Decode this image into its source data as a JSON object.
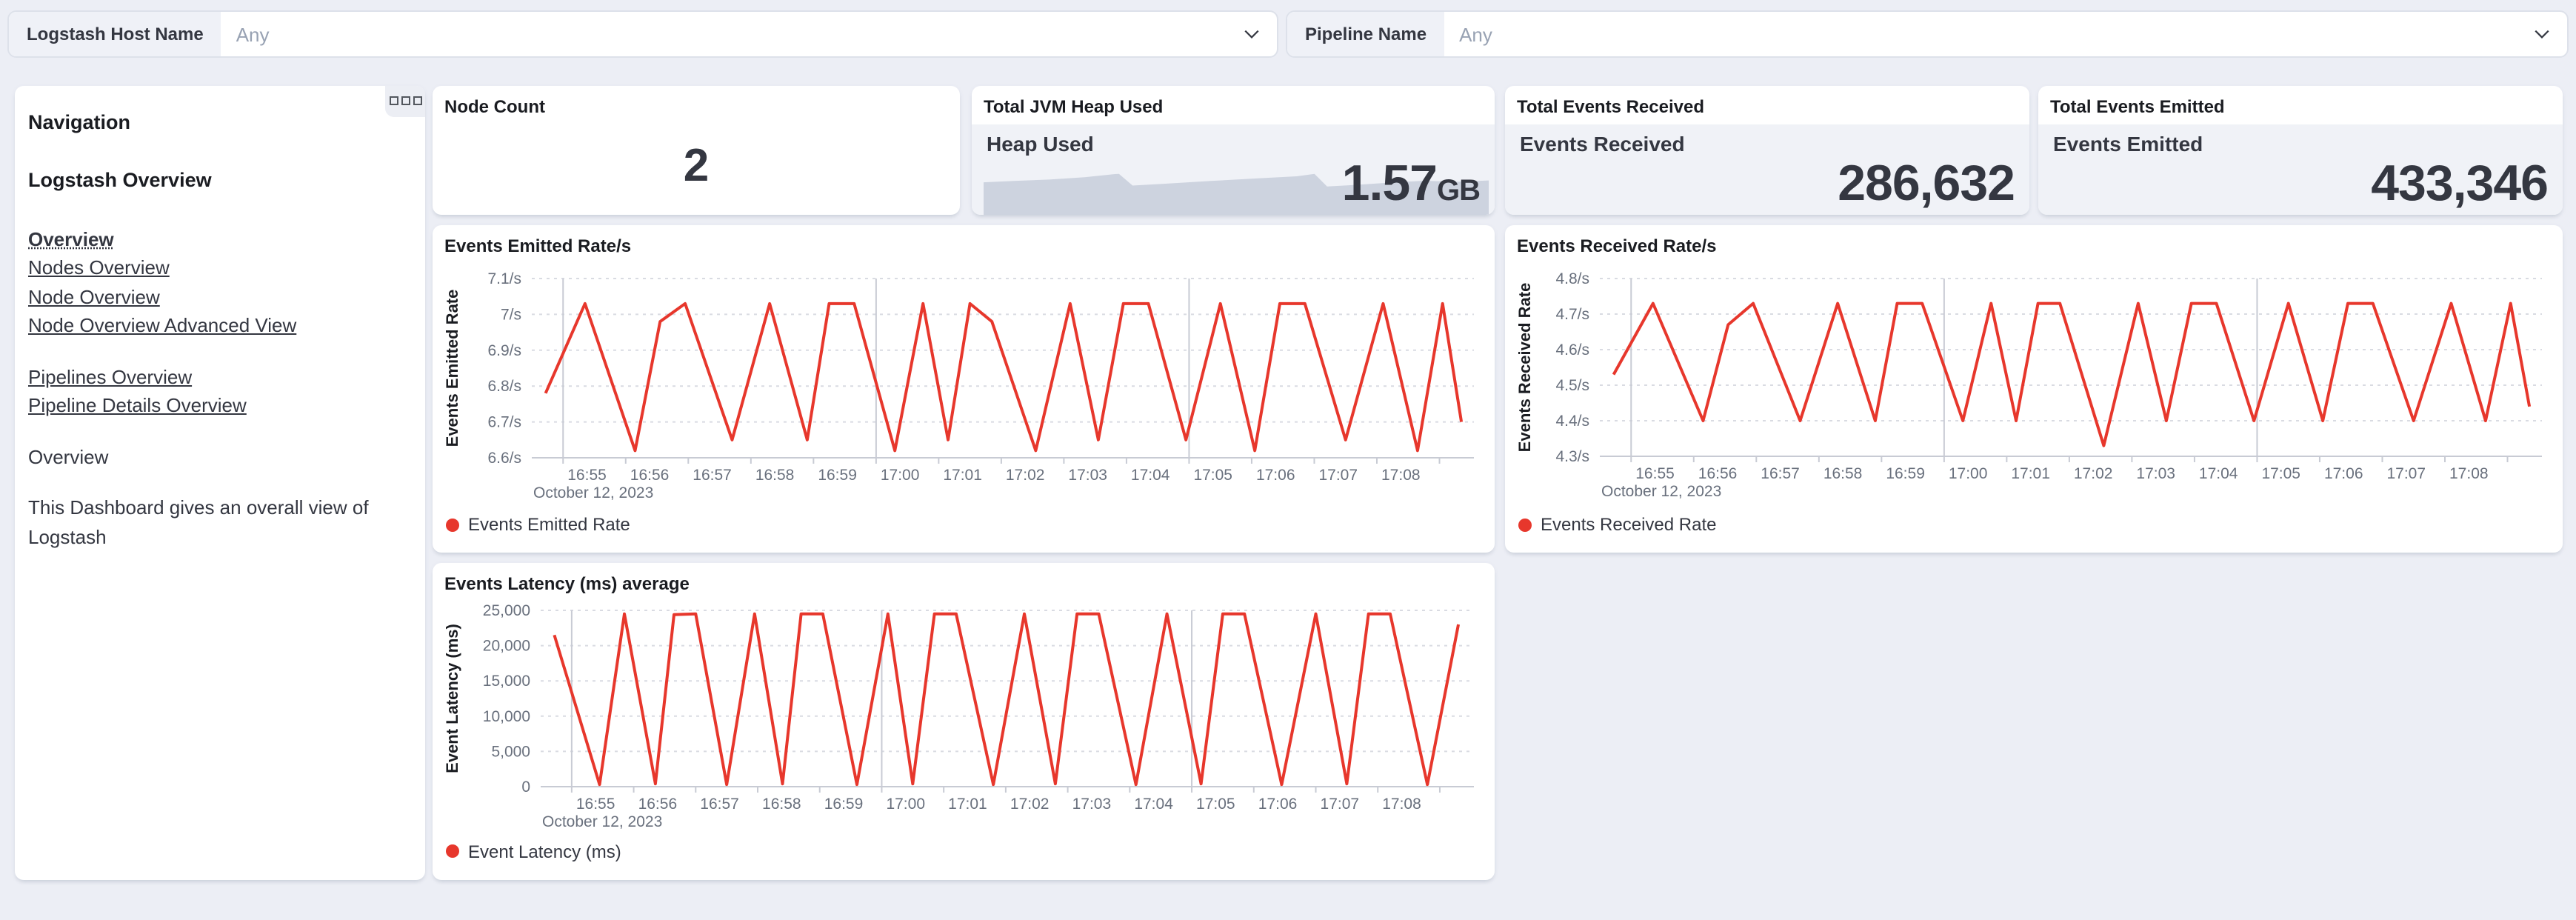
{
  "filters": {
    "host": {
      "label": "Logstash Host Name",
      "value": "Any"
    },
    "pipeline": {
      "label": "Pipeline Name",
      "value": "Any"
    }
  },
  "navigation": {
    "heading": "Navigation",
    "subheading": "Logstash Overview",
    "links_primary": [
      "Overview",
      "Nodes Overview",
      "Node Overview",
      "Node Overview Advanced View"
    ],
    "links_secondary": [
      "Pipelines Overview",
      "Pipeline Details Overview"
    ],
    "section_title": "Overview",
    "description": "This Dashboard gives an overall view of Logstash"
  },
  "metrics": {
    "node_count": {
      "title": "Node Count",
      "value": "2"
    },
    "jvm_heap": {
      "title": "Total JVM Heap Used",
      "label": "Heap Used",
      "value": "1.57",
      "unit": "GB",
      "trend": [
        [
          0,
          0.37
        ],
        [
          0.06,
          0.385
        ],
        [
          0.13,
          0.4
        ],
        [
          0.2,
          0.425
        ],
        [
          0.26,
          0.46
        ],
        [
          0.268,
          0.462
        ],
        [
          0.295,
          0.335
        ],
        [
          0.36,
          0.355
        ],
        [
          0.45,
          0.385
        ],
        [
          0.55,
          0.415
        ],
        [
          0.62,
          0.435
        ],
        [
          0.655,
          0.462
        ],
        [
          0.68,
          0.325
        ],
        [
          0.73,
          0.34
        ],
        [
          0.8,
          0.365
        ],
        [
          0.87,
          0.387
        ],
        [
          0.94,
          0.376
        ],
        [
          1,
          0.39
        ]
      ]
    },
    "events_received": {
      "title": "Total Events Received",
      "label": "Events Received",
      "value": "286,632"
    },
    "events_emitted": {
      "title": "Total Events Emitted",
      "label": "Events Emitted",
      "value": "433,346"
    }
  },
  "chart_data": [
    {
      "type": "line",
      "title": "Events Emitted Rate/s",
      "ylabel": "Events Emitted Rate",
      "legend": "Events Emitted Rate",
      "xlabel_date": "October 12, 2023",
      "ydomain": [
        6.6,
        7.1
      ],
      "yticks": [
        {
          "v": 7.1,
          "label": "7.1/s"
        },
        {
          "v": 7.0,
          "label": "7/s"
        },
        {
          "v": 6.9,
          "label": "6.9/s"
        },
        {
          "v": 6.8,
          "label": "6.8/s"
        },
        {
          "v": 6.7,
          "label": "6.7/s"
        },
        {
          "v": 6.6,
          "label": "6.6/s"
        }
      ],
      "xdomain_minutes": [
        54.5,
        69.55
      ],
      "xticks": [
        {
          "t": 55,
          "label": "16:55"
        },
        {
          "t": 56,
          "label": "16:56"
        },
        {
          "t": 57,
          "label": "16:57"
        },
        {
          "t": 58,
          "label": "16:58"
        },
        {
          "t": 59,
          "label": "16:59"
        },
        {
          "t": 60,
          "label": "17:00"
        },
        {
          "t": 61,
          "label": "17:01"
        },
        {
          "t": 62,
          "label": "17:02"
        },
        {
          "t": 63,
          "label": "17:03"
        },
        {
          "t": 64,
          "label": "17:04"
        },
        {
          "t": 65,
          "label": "17:05"
        },
        {
          "t": 66,
          "label": "17:06"
        },
        {
          "t": 67,
          "label": "17:07"
        },
        {
          "t": 68,
          "label": "17:08"
        },
        {
          "t": 69,
          "label": ""
        }
      ],
      "vlines_minutes": [
        55,
        60,
        65
      ],
      "series": [
        {
          "name": "Events Emitted Rate",
          "color": "#e7372c",
          "points": [
            [
              54.72,
              6.78
            ],
            [
              55.35,
              7.03
            ],
            [
              56.15,
              6.62
            ],
            [
              56.55,
              6.98
            ],
            [
              56.95,
              7.03
            ],
            [
              57.7,
              6.65
            ],
            [
              58.3,
              7.03
            ],
            [
              58.9,
              6.65
            ],
            [
              59.25,
              7.03
            ],
            [
              59.65,
              7.03
            ],
            [
              60.3,
              6.62
            ],
            [
              60.75,
              7.03
            ],
            [
              61.15,
              6.65
            ],
            [
              61.5,
              7.03
            ],
            [
              61.85,
              6.98
            ],
            [
              62.55,
              6.62
            ],
            [
              63.1,
              7.03
            ],
            [
              63.55,
              6.65
            ],
            [
              63.95,
              7.03
            ],
            [
              64.35,
              7.03
            ],
            [
              64.95,
              6.65
            ],
            [
              65.5,
              7.03
            ],
            [
              66.05,
              6.62
            ],
            [
              66.45,
              7.03
            ],
            [
              66.85,
              7.03
            ],
            [
              67.5,
              6.65
            ],
            [
              68.1,
              7.03
            ],
            [
              68.65,
              6.62
            ],
            [
              69.05,
              7.03
            ],
            [
              69.35,
              6.7
            ]
          ]
        }
      ]
    },
    {
      "type": "line",
      "title": "Events Received Rate/s",
      "ylabel": "Events Received Rate",
      "legend": "Events Received Rate",
      "xlabel_date": "October 12, 2023",
      "ydomain": [
        4.3,
        4.8
      ],
      "yticks": [
        {
          "v": 4.8,
          "label": "4.8/s"
        },
        {
          "v": 4.7,
          "label": "4.7/s"
        },
        {
          "v": 4.6,
          "label": "4.6/s"
        },
        {
          "v": 4.5,
          "label": "4.5/s"
        },
        {
          "v": 4.4,
          "label": "4.4/s"
        },
        {
          "v": 4.3,
          "label": "4.3/s"
        }
      ],
      "xdomain_minutes": [
        54.5,
        69.55
      ],
      "xticks": [
        {
          "t": 55,
          "label": "16:55"
        },
        {
          "t": 56,
          "label": "16:56"
        },
        {
          "t": 57,
          "label": "16:57"
        },
        {
          "t": 58,
          "label": "16:58"
        },
        {
          "t": 59,
          "label": "16:59"
        },
        {
          "t": 60,
          "label": "17:00"
        },
        {
          "t": 61,
          "label": "17:01"
        },
        {
          "t": 62,
          "label": "17:02"
        },
        {
          "t": 63,
          "label": "17:03"
        },
        {
          "t": 64,
          "label": "17:04"
        },
        {
          "t": 65,
          "label": "17:05"
        },
        {
          "t": 66,
          "label": "17:06"
        },
        {
          "t": 67,
          "label": "17:07"
        },
        {
          "t": 68,
          "label": "17:08"
        },
        {
          "t": 69,
          "label": ""
        }
      ],
      "vlines_minutes": [
        55,
        60,
        65
      ],
      "series": [
        {
          "name": "Events Received Rate",
          "color": "#e7372c",
          "points": [
            [
              54.72,
              4.53
            ],
            [
              55.35,
              4.73
            ],
            [
              56.15,
              4.4
            ],
            [
              56.55,
              4.67
            ],
            [
              56.95,
              4.73
            ],
            [
              57.7,
              4.4
            ],
            [
              58.3,
              4.73
            ],
            [
              58.9,
              4.4
            ],
            [
              59.25,
              4.73
            ],
            [
              59.65,
              4.73
            ],
            [
              60.3,
              4.4
            ],
            [
              60.75,
              4.73
            ],
            [
              61.15,
              4.4
            ],
            [
              61.5,
              4.73
            ],
            [
              61.85,
              4.73
            ],
            [
              62.55,
              4.33
            ],
            [
              63.1,
              4.73
            ],
            [
              63.55,
              4.4
            ],
            [
              63.95,
              4.73
            ],
            [
              64.35,
              4.73
            ],
            [
              64.95,
              4.4
            ],
            [
              65.5,
              4.73
            ],
            [
              66.05,
              4.4
            ],
            [
              66.45,
              4.73
            ],
            [
              66.85,
              4.73
            ],
            [
              67.5,
              4.4
            ],
            [
              68.1,
              4.73
            ],
            [
              68.65,
              4.4
            ],
            [
              69.05,
              4.73
            ],
            [
              69.35,
              4.44
            ]
          ]
        }
      ]
    },
    {
      "type": "line",
      "title": "Events Latency (ms) average",
      "ylabel": "Event Latency (ms)",
      "legend": "Event Latency (ms)",
      "xlabel_date": "October 12, 2023",
      "ydomain": [
        0,
        25000
      ],
      "yticks": [
        {
          "v": 25000,
          "label": "25,000"
        },
        {
          "v": 20000,
          "label": "20,000"
        },
        {
          "v": 15000,
          "label": "15,000"
        },
        {
          "v": 10000,
          "label": "10,000"
        },
        {
          "v": 5000,
          "label": "5,000"
        },
        {
          "v": 0,
          "label": "0"
        }
      ],
      "xdomain_minutes": [
        54.5,
        69.55
      ],
      "xticks": [
        {
          "t": 55,
          "label": "16:55"
        },
        {
          "t": 56,
          "label": "16:56"
        },
        {
          "t": 57,
          "label": "16:57"
        },
        {
          "t": 58,
          "label": "16:58"
        },
        {
          "t": 59,
          "label": "16:59"
        },
        {
          "t": 60,
          "label": "17:00"
        },
        {
          "t": 61,
          "label": "17:01"
        },
        {
          "t": 62,
          "label": "17:02"
        },
        {
          "t": 63,
          "label": "17:03"
        },
        {
          "t": 64,
          "label": "17:04"
        },
        {
          "t": 65,
          "label": "17:05"
        },
        {
          "t": 66,
          "label": "17:06"
        },
        {
          "t": 67,
          "label": "17:07"
        },
        {
          "t": 68,
          "label": "17:08"
        },
        {
          "t": 69,
          "label": ""
        }
      ],
      "vlines_minutes": [
        55,
        60,
        65
      ],
      "series": [
        {
          "name": "Event Latency (ms)",
          "color": "#e7372c",
          "points": [
            [
              54.72,
              21500
            ],
            [
              55.45,
              300
            ],
            [
              55.85,
              24500
            ],
            [
              56.35,
              400
            ],
            [
              56.65,
              24400
            ],
            [
              57.0,
              24500
            ],
            [
              57.5,
              300
            ],
            [
              57.95,
              24500
            ],
            [
              58.4,
              400
            ],
            [
              58.7,
              24500
            ],
            [
              59.05,
              24500
            ],
            [
              59.6,
              300
            ],
            [
              60.1,
              24500
            ],
            [
              60.5,
              400
            ],
            [
              60.85,
              24500
            ],
            [
              61.2,
              24500
            ],
            [
              61.8,
              300
            ],
            [
              62.3,
              24500
            ],
            [
              62.8,
              400
            ],
            [
              63.15,
              24500
            ],
            [
              63.5,
              24500
            ],
            [
              64.1,
              300
            ],
            [
              64.6,
              24500
            ],
            [
              65.15,
              400
            ],
            [
              65.5,
              24500
            ],
            [
              65.85,
              24500
            ],
            [
              66.45,
              300
            ],
            [
              67.0,
              24500
            ],
            [
              67.5,
              400
            ],
            [
              67.85,
              24500
            ],
            [
              68.2,
              24500
            ],
            [
              68.8,
              300
            ],
            [
              69.3,
              23000
            ]
          ]
        }
      ]
    }
  ],
  "colors": {
    "accent_red": "#e7372c",
    "heap_area": "#cdd3df",
    "page_bg": "#eceef5",
    "panel_bg": "#ffffff",
    "grid": "#d9dbe2",
    "axis": "#c8cbd4",
    "tick_text": "#69707d",
    "text": "#343741",
    "title_text": "#1a1c21"
  }
}
